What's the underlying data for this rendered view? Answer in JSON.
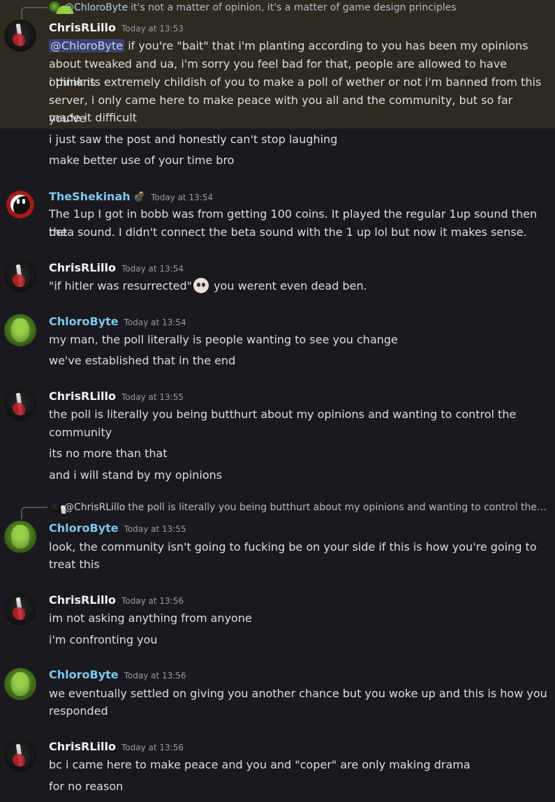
{
  "colors": {
    "background": "#1a1a1e",
    "highlight_background": "#2f2a1f",
    "text": "#dbdee1",
    "timestamp": "#949ba4",
    "chris_name": "#f2f3f5",
    "chloro_name": "#7dc7ee",
    "mention_bg": "#3c4270"
  },
  "messages": {
    "g1": {
      "reply_user": "@ChloroByte",
      "reply_text": "it's not a matter of opinion, it's a matter of game design principles",
      "user": "ChrisRLillo",
      "time": "Today at 13:53",
      "mention": "@ChloroByte",
      "l1_rest": " if you're \"bait\" that i'm planting according to you has been my opinions",
      "l2": "about tweaked and ua, i'm sorry you feel bad for that, people are allowed to have opinions",
      "l3": "i think its extremely childish of you to make a poll of wether or not i'm banned from this",
      "l4": "server, i only came here to make peace with you all and the community, but so far you've",
      "l5": "made it difficult",
      "m2": "i just saw the post and honestly can't stop laughing",
      "m3": "make better use of your time bro"
    },
    "g2": {
      "user": "TheShekinah",
      "badge_icon": "bomb-icon",
      "time": "Today at 13:54",
      "l1": "The 1up I got in bobb was from getting 100 coins. It played the regular 1up sound then the",
      "l2": "beta sound. I didn't connect the beta sound with the 1 up lol but now it makes sense."
    },
    "g3": {
      "user": "ChrisRLillo",
      "time": "Today at 13:54",
      "before_emoji": "\"if hitler was resurrected\"",
      "emoji": "skull-emoji",
      "after_emoji": " you werent even dead ben."
    },
    "g4": {
      "user": "ChloroByte",
      "time": "Today at 13:54",
      "m1": "my man, the poll literally is people wanting to see you change",
      "m2": "we've established that in the end"
    },
    "g5": {
      "user": "ChrisRLillo",
      "time": "Today at 13:55",
      "l1": "the poll is literally you being butthurt about my opinions and wanting to control the",
      "l2": "community",
      "m2": "its no more than that",
      "m3": "and i will stand by my opinions"
    },
    "g6": {
      "reply_user": "@ChrisRLillo",
      "reply_text": "the poll is literally you being butthurt about my opinions and wanting to control the ...",
      "user": "ChloroByte",
      "time": "Today at 13:55",
      "l1": "look, the community isn't going to fucking be on your side if this is how you're going to",
      "l2": "treat this"
    },
    "g7": {
      "user": "ChrisRLillo",
      "time": "Today at 13:56",
      "m1": "im not asking anything from anyone",
      "m2": "i'm confronting you"
    },
    "g8": {
      "user": "ChloroByte",
      "time": "Today at 13:56",
      "l1": "we eventually settled on giving you another chance but you woke up and this is how you",
      "l2": "responded"
    },
    "g9": {
      "user": "ChrisRLillo",
      "time": "Today at 13:56",
      "m1": "bc i came here to make peace and you and \"coper\" are only making drama",
      "m2": "for no reason"
    }
  }
}
